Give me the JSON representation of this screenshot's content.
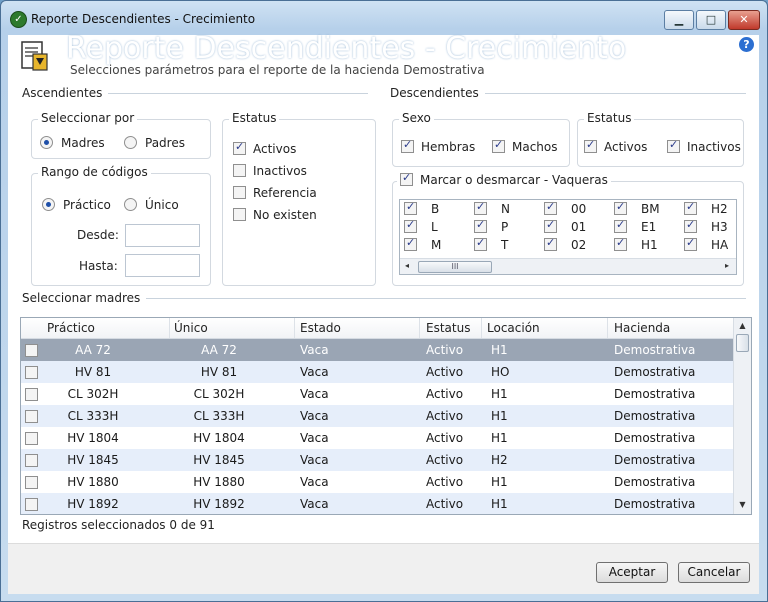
{
  "window": {
    "title": "Reporte Descendientes - Crecimiento",
    "minimize": "▁",
    "maximize": "□",
    "close": "✕"
  },
  "header": {
    "title": "Reporte Descendientes - Crecimiento",
    "subtitle": "Selecciones parámetros para el reporte de la hacienda Demostrativa",
    "help": "?"
  },
  "ascendientes": {
    "label": "Ascendientes",
    "seleccionar_por": {
      "label": "Seleccionar por",
      "options": [
        {
          "label": "Madres",
          "checked": true
        },
        {
          "label": "Padres",
          "checked": false
        }
      ]
    },
    "rango": {
      "label": "Rango de códigos",
      "options": [
        {
          "label": "Práctico",
          "checked": true
        },
        {
          "label": "Único",
          "checked": false
        }
      ],
      "desde_label": "Desde:",
      "desde_value": "",
      "hasta_label": "Hasta:",
      "hasta_value": ""
    },
    "estatus": {
      "label": "Estatus",
      "options": [
        {
          "label": "Activos",
          "checked": true
        },
        {
          "label": "Inactivos",
          "checked": false
        },
        {
          "label": "Referencia",
          "checked": false
        },
        {
          "label": "No existen",
          "checked": false
        }
      ]
    }
  },
  "descendientes": {
    "label": "Descendientes",
    "sexo": {
      "label": "Sexo",
      "options": [
        {
          "label": "Hembras",
          "checked": true
        },
        {
          "label": "Machos",
          "checked": true
        }
      ]
    },
    "estatus": {
      "label": "Estatus",
      "options": [
        {
          "label": "Activos",
          "checked": true
        },
        {
          "label": "Inactivos",
          "checked": true
        }
      ]
    },
    "vaqueras": {
      "label": "Marcar o desmarcar - Vaqueras",
      "checked": true,
      "items": [
        "B",
        "N",
        "00",
        "BM",
        "H2",
        "L",
        "P",
        "01",
        "E1",
        "H3",
        "M",
        "T",
        "02",
        "H1",
        "HA"
      ],
      "scroll_thumb": "III"
    }
  },
  "madres": {
    "label": "Seleccionar madres",
    "columns": [
      "Práctico",
      "Único",
      "Estado",
      "Estatus",
      "Locación",
      "Hacienda"
    ],
    "rows": [
      [
        "AA 72",
        "AA 72",
        "Vaca",
        "Activo",
        "H1",
        "Demostrativa"
      ],
      [
        "HV 81",
        "HV 81",
        "Vaca",
        "Activo",
        "HO",
        "Demostrativa"
      ],
      [
        "CL 302H",
        "CL 302H",
        "Vaca",
        "Activo",
        "H1",
        "Demostrativa"
      ],
      [
        "CL 333H",
        "CL 333H",
        "Vaca",
        "Activo",
        "H1",
        "Demostrativa"
      ],
      [
        "HV 1804",
        "HV 1804",
        "Vaca",
        "Activo",
        "H1",
        "Demostrativa"
      ],
      [
        "HV 1845",
        "HV 1845",
        "Vaca",
        "Activo",
        "H2",
        "Demostrativa"
      ],
      [
        "HV 1880",
        "HV 1880",
        "Vaca",
        "Activo",
        "H1",
        "Demostrativa"
      ],
      [
        "HV 1892",
        "HV 1892",
        "Vaca",
        "Activo",
        "H1",
        "Demostrativa"
      ]
    ],
    "selected_row": 0,
    "footer": "Registros seleccionados 0 de 91"
  },
  "buttons": {
    "accept": "Aceptar",
    "cancel": "Cancelar"
  }
}
